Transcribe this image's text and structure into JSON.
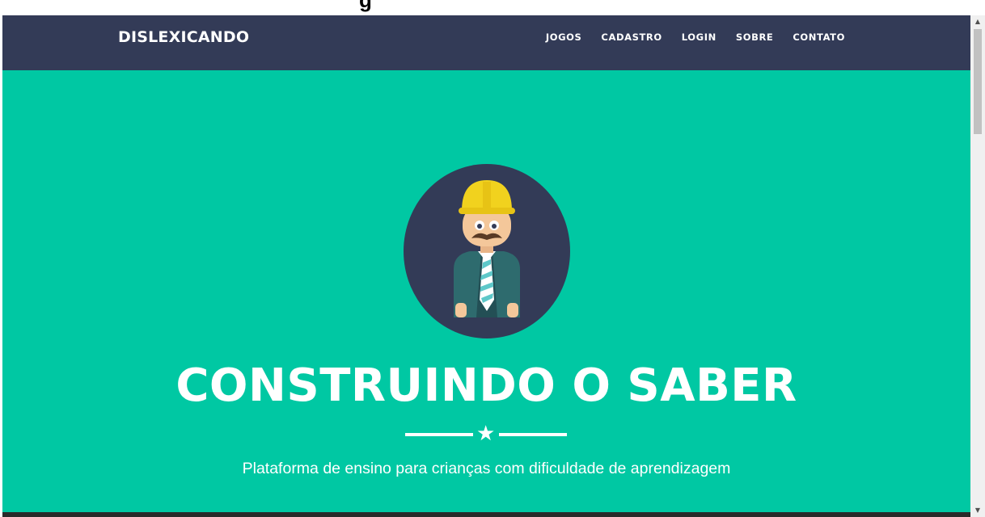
{
  "header": {
    "brand": "DISLEXICANDO",
    "nav": [
      {
        "label": "JOGOS"
      },
      {
        "label": "CADASTRO"
      },
      {
        "label": "LOGIN"
      },
      {
        "label": "SOBRE"
      },
      {
        "label": "CONTATO"
      }
    ]
  },
  "hero": {
    "title": "CONSTRUINDO O SABER",
    "divider_icon": "star-icon",
    "subtitle": "Plataforma de ensino para crianças com dificuldade de aprendizagem",
    "avatar_icon": "construction-worker-icon"
  },
  "top_overlay": {
    "text": "g"
  },
  "colors": {
    "navbar": "#333b57",
    "hero_bg": "#00c8a3",
    "text": "#ffffff",
    "helmet": "#f1d21e"
  }
}
